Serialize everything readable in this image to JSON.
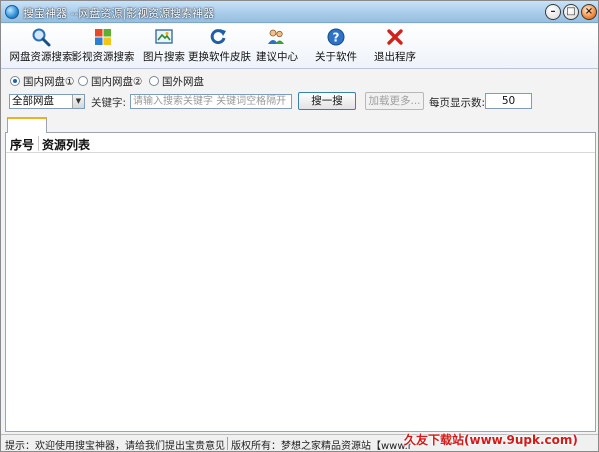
{
  "window": {
    "title": "搜宝神器 --网盘资源|影视资源搜索神器"
  },
  "toolbar": {
    "buttons": [
      {
        "label": "网盘资源搜索",
        "icon": "magnifier-icon"
      },
      {
        "label": "影视资源搜索",
        "icon": "windows-logo-icon"
      },
      {
        "label": "图片搜索",
        "icon": "picture-icon"
      },
      {
        "label": "更换软件皮肤",
        "icon": "refresh-icon"
      },
      {
        "label": "建议中心",
        "icon": "users-icon"
      },
      {
        "label": "关于软件",
        "icon": "help-icon"
      },
      {
        "label": "退出程序",
        "icon": "close-x-icon"
      }
    ]
  },
  "search": {
    "radios": [
      {
        "label": "国内网盘①",
        "selected": true
      },
      {
        "label": "国内网盘②",
        "selected": false
      },
      {
        "label": "国外网盘",
        "selected": false
      }
    ],
    "disk_select": "全部网盘",
    "keyword_label": "关键字:",
    "keyword_placeholder": "请输入搜索关键字 关键词空格隔开",
    "search_button": "搜一搜",
    "load_more_button": "加载更多...",
    "per_page_label": "每页显示数:",
    "per_page_value": "50"
  },
  "list": {
    "columns": [
      "序号",
      "资源列表"
    ]
  },
  "status": {
    "left": "提示：欢迎使用搜宝神器，请给我们提出宝贵意见...",
    "right": "版权所有：梦想之家精品资源站【www.my"
  },
  "watermark": "久友下载站(www.9upk.com)"
}
